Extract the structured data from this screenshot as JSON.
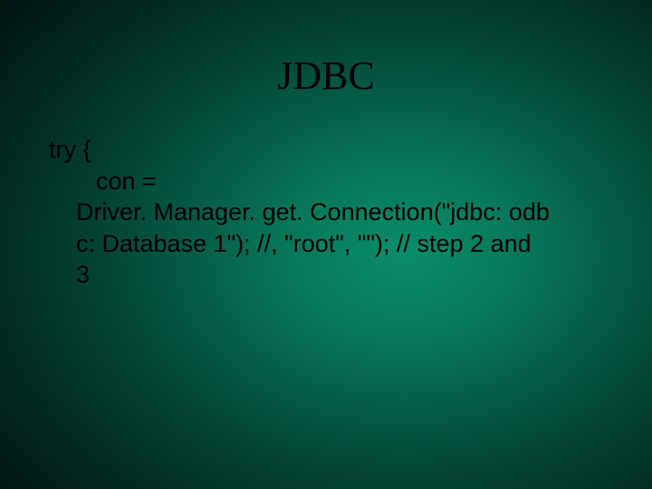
{
  "title": "JDBC",
  "code": {
    "try_line": "try {",
    "con_line": "con =",
    "l1": "Driver. Manager. get. Connection(\"jdbc: odb",
    "l2": "c: Database 1\"); //, \"root\", \"\"); // step 2 and",
    "l3": "3"
  }
}
